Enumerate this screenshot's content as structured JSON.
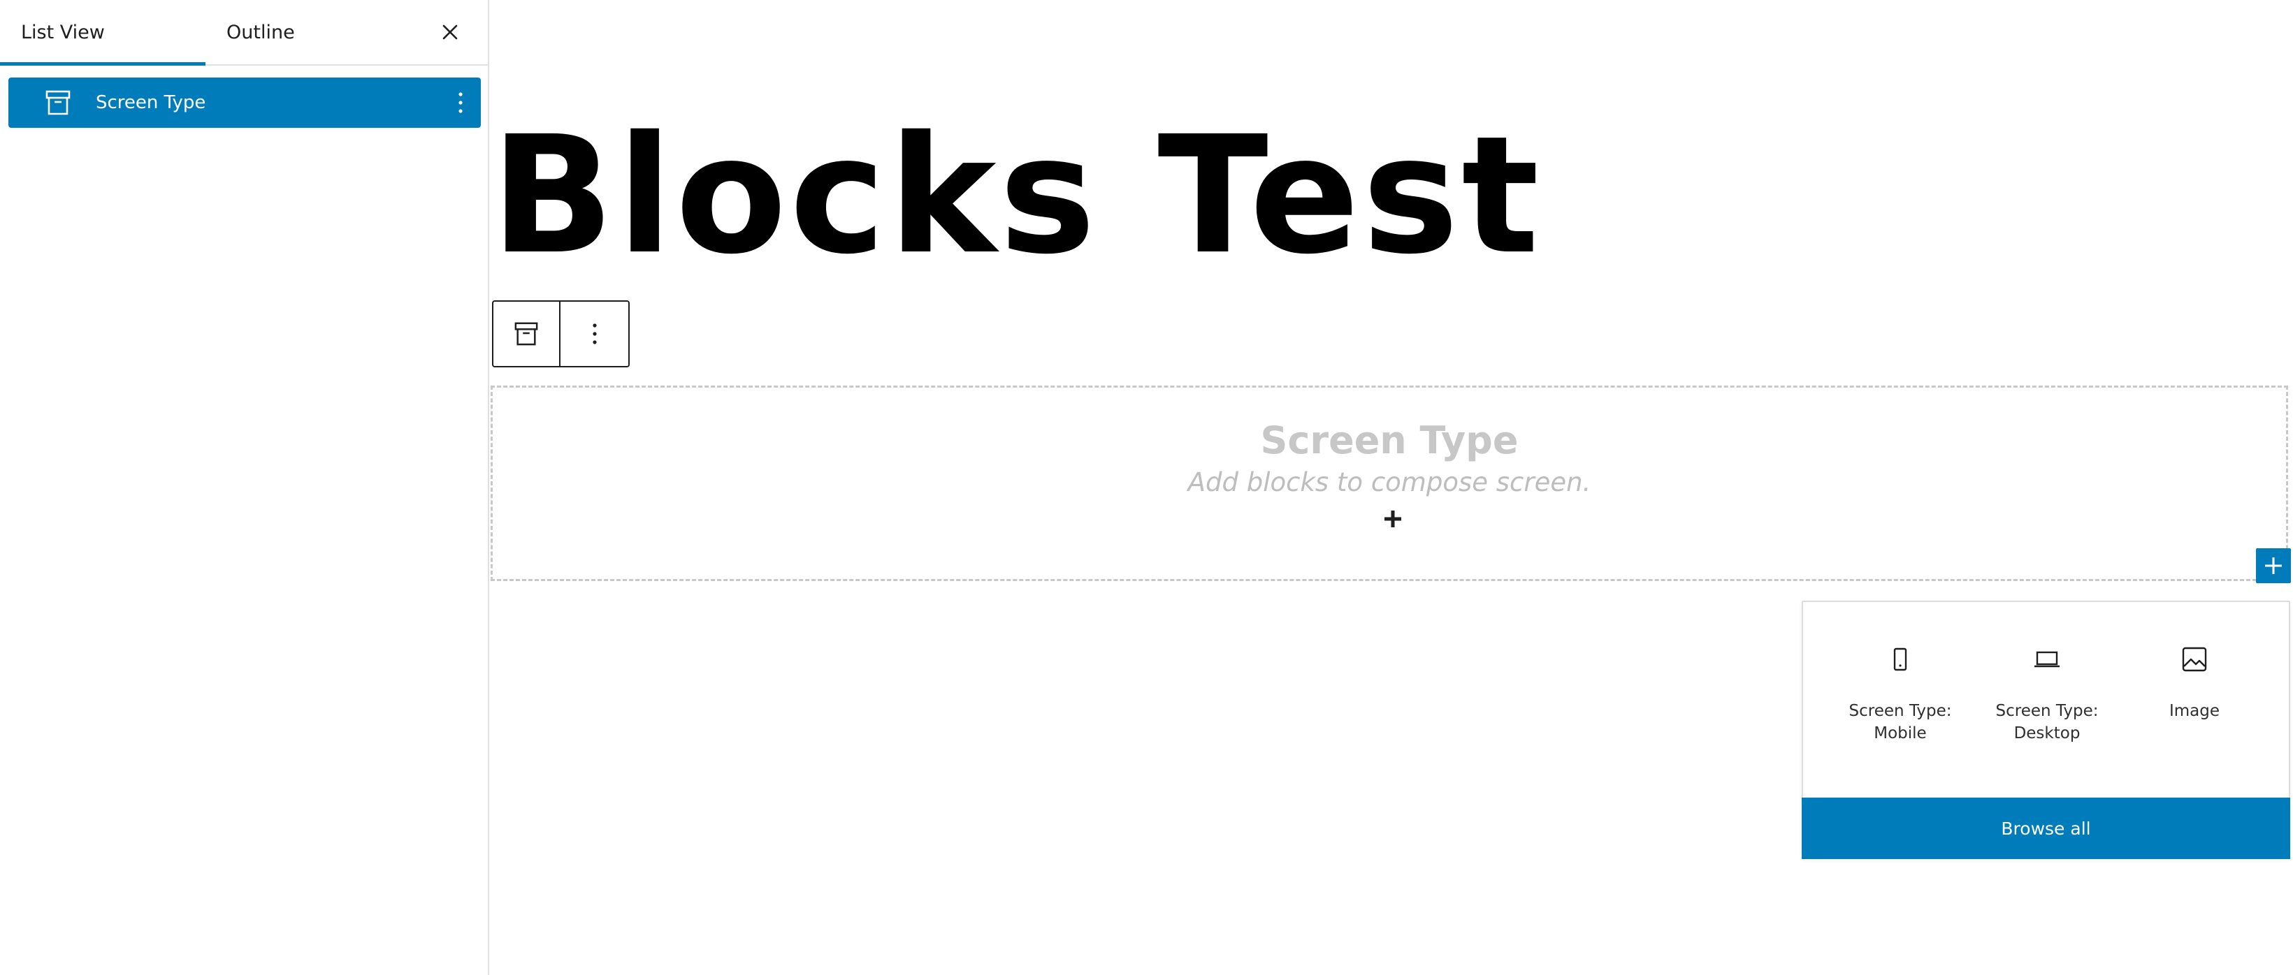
{
  "colors": {
    "accent": "#007cba",
    "placeholder_text": "#c7c7c7",
    "border": "#e0e0e0"
  },
  "sidebar": {
    "tabs": [
      {
        "label": "List View",
        "active": true
      },
      {
        "label": "Outline",
        "active": false
      }
    ],
    "close_icon": "close-icon",
    "items": [
      {
        "label": "Screen Type",
        "icon": "archive-box-icon",
        "selected": true,
        "options_icon": "more-vertical-icon"
      }
    ]
  },
  "canvas": {
    "title": "Blocks Test",
    "toolbar": {
      "parent_icon": "archive-box-icon",
      "options_icon": "more-vertical-icon"
    },
    "placeholder": {
      "title": "Screen Type",
      "subtitle": "Add blocks to compose screen.",
      "add_icon": "plus-icon"
    },
    "inserter_icon": "plus-icon"
  },
  "inserter": {
    "blocks": [
      {
        "label": "Screen Type: Mobile",
        "icon": "mobile-icon"
      },
      {
        "label": "Screen Type: Desktop",
        "icon": "desktop-icon"
      },
      {
        "label": "Image",
        "icon": "image-icon"
      }
    ],
    "browse_all_label": "Browse all"
  }
}
